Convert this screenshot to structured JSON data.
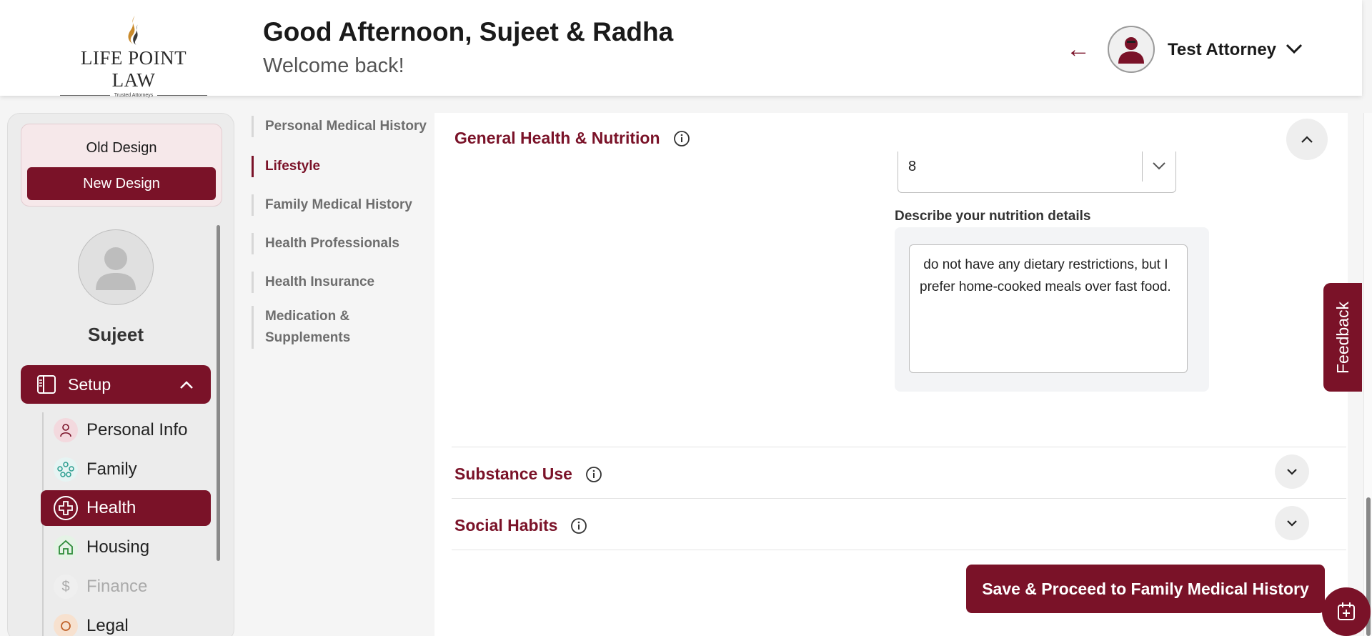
{
  "header": {
    "logo_text": "LIFE POINT LAW",
    "logo_tagline": "Trusted Attorneys",
    "greeting": "Good Afternoon, Sujeet & Radha",
    "welcome": "Welcome back!",
    "user_name": "Test Attorney"
  },
  "sidebar": {
    "old_design": "Old Design",
    "new_design": "New Design",
    "profile_name": "Sujeet",
    "setup_label": "Setup",
    "items": [
      {
        "label": "Personal Info",
        "icon": "person-icon",
        "state": "normal"
      },
      {
        "label": "Family",
        "icon": "family-icon",
        "state": "normal"
      },
      {
        "label": "Health",
        "icon": "health-cross-icon",
        "state": "active"
      },
      {
        "label": "Housing",
        "icon": "house-icon",
        "state": "normal"
      },
      {
        "label": "Finance",
        "icon": "dollar-icon",
        "state": "disabled"
      },
      {
        "label": "Legal",
        "icon": "legal-icon",
        "state": "normal"
      }
    ]
  },
  "section_nav": [
    {
      "label": "Personal Medical History",
      "active": false
    },
    {
      "label": "Lifestyle",
      "active": true
    },
    {
      "label": "Family Medical History",
      "active": false
    },
    {
      "label": "Health Professionals",
      "active": false
    },
    {
      "label": "Health Insurance",
      "active": false
    },
    {
      "label": "Medication & Supplements",
      "active": false
    }
  ],
  "main": {
    "general_title": "General Health & Nutrition",
    "select_value": "8",
    "nutrition_label": "Describe your nutrition details",
    "nutrition_text": " do not have any dietary restrictions, but I prefer home-cooked meals over fast food.",
    "substance_title": "Substance Use",
    "social_title": "Social Habits",
    "save_button": "Save & Proceed to Family Medical History"
  },
  "feedback_label": "Feedback",
  "colors": {
    "brand": "#7a1228",
    "accent_gold": "#c98a2b"
  }
}
